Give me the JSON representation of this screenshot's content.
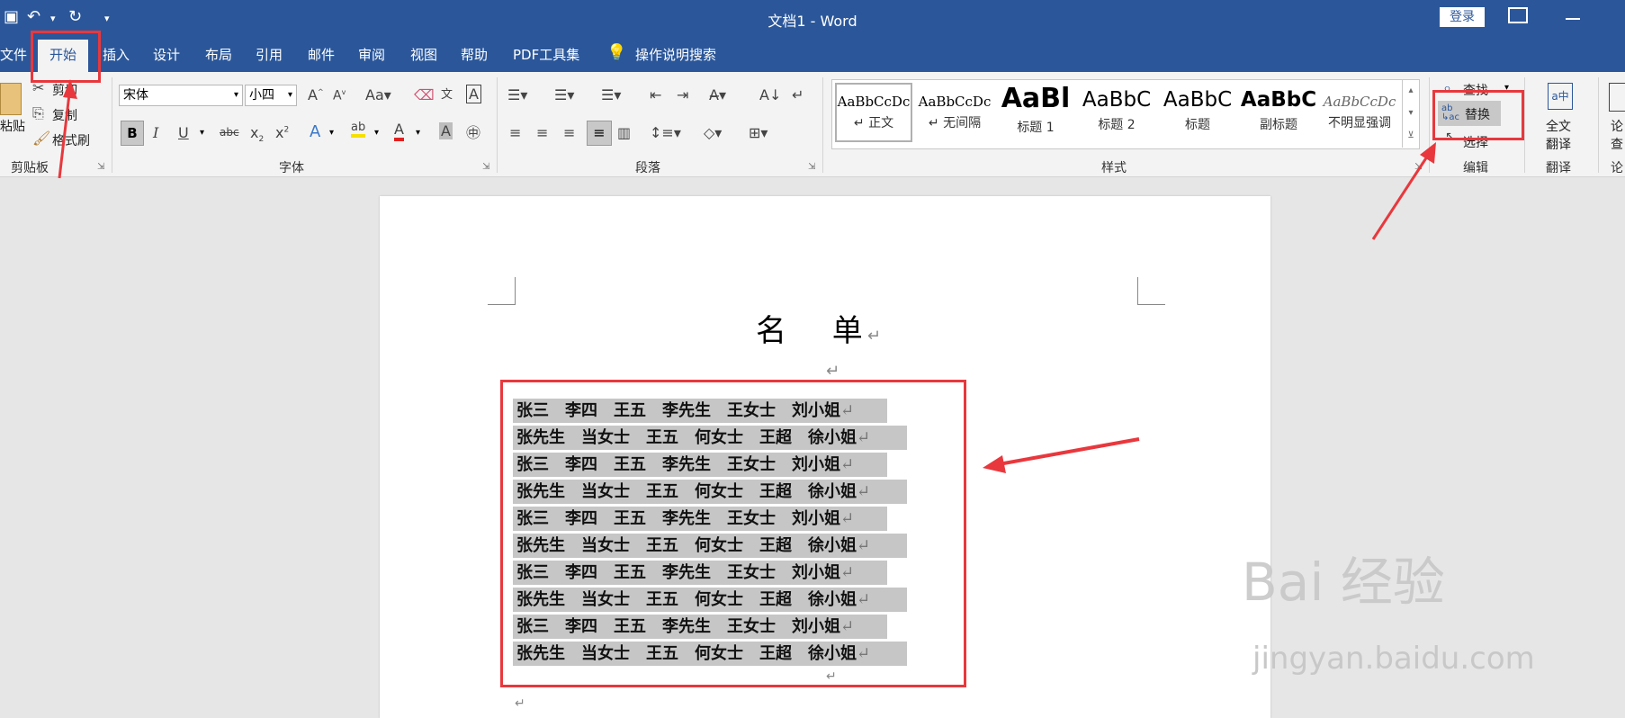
{
  "titlebar": {
    "doc_title": "文档1 - Word",
    "login_label": "登录"
  },
  "tabs": [
    {
      "label": "文件"
    },
    {
      "label": "开始"
    },
    {
      "label": "插入"
    },
    {
      "label": "设计"
    },
    {
      "label": "布局"
    },
    {
      "label": "引用"
    },
    {
      "label": "邮件"
    },
    {
      "label": "审阅"
    },
    {
      "label": "视图"
    },
    {
      "label": "帮助"
    },
    {
      "label": "PDF工具集"
    },
    {
      "label": "操作说明搜索"
    }
  ],
  "clipboard": {
    "paste_label": "粘贴",
    "cut_label": "剪切",
    "copy_label": "复制",
    "format_painter_label": "格式刷",
    "group_label": "剪贴板"
  },
  "font": {
    "font_name": "宋体",
    "font_size": "小四",
    "group_label": "字体"
  },
  "paragraph": {
    "group_label": "段落"
  },
  "styles": {
    "items": [
      {
        "preview": "AaBbCcDc",
        "name": "↵ 正文"
      },
      {
        "preview": "AaBbCcDc",
        "name": "↵ 无间隔"
      },
      {
        "preview": "AaBl",
        "name": "标题 1"
      },
      {
        "preview": "AaBbC",
        "name": "标题 2"
      },
      {
        "preview": "AaBbC",
        "name": "标题"
      },
      {
        "preview": "AaBbC",
        "name": "副标题"
      },
      {
        "preview": "AaBbCcDc",
        "name": "不明显强调"
      }
    ],
    "group_label": "样式"
  },
  "editing": {
    "find_label": "查找",
    "replace_label": "替换",
    "select_label": "选择",
    "group_label": "编辑"
  },
  "translate": {
    "full_text_label_1": "全文",
    "full_text_label_2": "翻译",
    "group_label": "翻译"
  },
  "paper": {
    "label_1": "论",
    "label_2": "查",
    "group_label": "论"
  },
  "document": {
    "heading": "名 单",
    "lines": [
      "张三　李四　王五　李先生　王女士　刘小姐",
      "张先生　当女士　王五　何女士　王超　徐小姐",
      "张三　李四　王五　李先生　王女士　刘小姐",
      "张先生　当女士　王五　何女士　王超　徐小姐",
      "张三　李四　王五　李先生　王女士　刘小姐",
      "张先生　当女士　王五　何女士　王超　徐小姐",
      "张三　李四　王五　李先生　王女士　刘小姐",
      "张先生　当女士　王五　何女士　王超　徐小姐",
      "张三　李四　王五　李先生　王女士　刘小姐",
      "张先生　当女士　王五　何女士　王超　徐小姐"
    ],
    "paragraph_mark": "↵"
  },
  "watermark": {
    "brand": "Bai 经验",
    "url": "jingyan.baidu.com"
  },
  "colors": {
    "accent": "#2b579a",
    "annotation_red": "#e8383d",
    "selection_gray": "#c6c6c6"
  }
}
